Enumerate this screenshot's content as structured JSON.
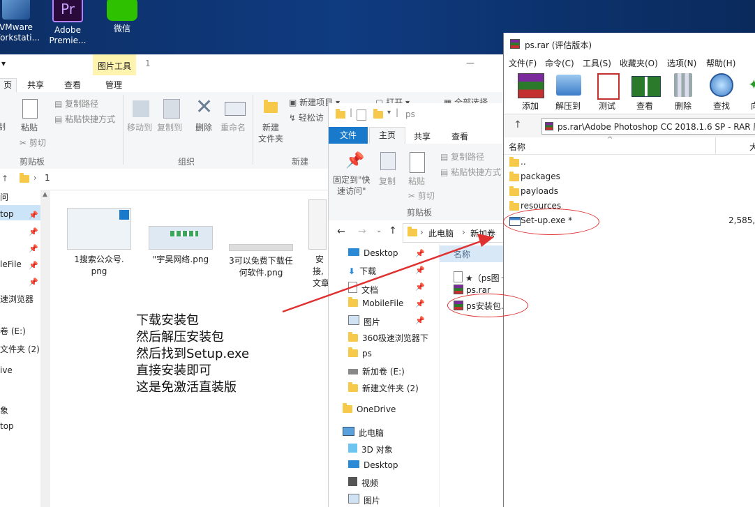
{
  "desktop": {
    "icons": [
      {
        "label1": "VMware",
        "label2": "Workstati..."
      },
      {
        "label1": "Adobe",
        "label2": "Premie..."
      },
      {
        "label1": "微信",
        "label2": ""
      }
    ]
  },
  "explorer1": {
    "context_tab": "图片工具",
    "window_title": "1",
    "tabs": [
      "页",
      "共享",
      "查看",
      "管理"
    ],
    "ribbon": {
      "copy_path": "复制路径",
      "paste_shortcut": "粘贴快捷方式",
      "cut": "剪切",
      "clipboard_group": "剪贴板",
      "paste": "粘贴",
      "copy_fragment": "制",
      "move_to": "移动到",
      "copy_to": "复制到",
      "delete": "删除",
      "rename": "重命名",
      "organize_group": "组织",
      "new_item": "新建项目",
      "easy_access": "轻松访",
      "new_folder_line1": "新建",
      "new_folder_line2": "文件夹",
      "new_group": "新建",
      "open": "打开",
      "select_all": "全部选择"
    },
    "address_path": "1",
    "nav_items": [
      {
        "label": "问",
        "pinned": false
      },
      {
        "label": "top",
        "pinned": true
      },
      {
        "label": "",
        "pinned": true
      },
      {
        "label": "",
        "pinned": true
      },
      {
        "label": "leFile",
        "pinned": true
      },
      {
        "label": "",
        "pinned": true
      },
      {
        "label": "速浏览器",
        "pinned": false
      },
      {
        "label": "卷 (E:)",
        "pinned": false
      },
      {
        "label": "文件夹 (2)",
        "pinned": false
      },
      {
        "label": "ive",
        "pinned": false
      },
      {
        "label": "象",
        "pinned": false
      },
      {
        "label": "top",
        "pinned": false
      }
    ],
    "files": [
      {
        "line1": "1搜索公众号.",
        "line2": "png"
      },
      {
        "line1": "\"宇昊网络.png",
        "line2": ""
      },
      {
        "line1": "3可以免费下载任",
        "line2": "何软件.png"
      },
      {
        "line1": "安",
        "line2": "接,",
        "line3": "文章"
      }
    ],
    "note_lines": [
      "下载安装包",
      "然后解压安装包",
      "然后找到Setup.exe",
      "直接安装即可",
      "这是免激活直装版"
    ]
  },
  "explorer2": {
    "title": "ps",
    "tabs": [
      "文件",
      "主页",
      "共享",
      "查看"
    ],
    "ribbon": {
      "pin_line1": "固定到\"快",
      "pin_line2": "速访问\"",
      "copy": "复制",
      "paste": "粘贴",
      "copy_path": "复制路径",
      "paste_shortcut": "粘贴快捷方式",
      "cut": "剪切",
      "clipboard_group": "剪贴板"
    },
    "breadcrumb": [
      "此电脑",
      "新加卷"
    ],
    "column_header": "名称",
    "nav_items": [
      {
        "label": "Desktop",
        "icon": "desktop",
        "pinned": true
      },
      {
        "label": "下载",
        "icon": "download",
        "pinned": true
      },
      {
        "label": "文档",
        "icon": "document",
        "pinned": true
      },
      {
        "label": "MobileFile",
        "icon": "folder",
        "pinned": true
      },
      {
        "label": "图片",
        "icon": "picture",
        "pinned": true
      },
      {
        "label": "360极速浏览器下",
        "icon": "folder",
        "pinned": false
      },
      {
        "label": "ps",
        "icon": "folder",
        "pinned": false
      },
      {
        "label": "新加卷 (E:)",
        "icon": "drive",
        "pinned": false
      },
      {
        "label": "新建文件夹 (2)",
        "icon": "folder",
        "pinned": false
      },
      {
        "label": "OneDrive",
        "icon": "folder",
        "pinned": false
      },
      {
        "label": "此电脑",
        "icon": "pc",
        "pinned": false
      },
      {
        "label": "3D 对象",
        "icon": "3d",
        "pinned": false
      },
      {
        "label": "Desktop",
        "icon": "desktop",
        "pinned": false
      },
      {
        "label": "视频",
        "icon": "video",
        "pinned": false
      },
      {
        "label": "图片",
        "icon": "picture",
        "pinned": false
      }
    ],
    "files": [
      {
        "label": "★（ps图᠁",
        "icon": "text"
      },
      {
        "label": "ps.rar",
        "icon": "rar"
      },
      {
        "label": "ps安装包.",
        "icon": "rar"
      }
    ]
  },
  "winrar": {
    "title": "ps.rar (评估版本)",
    "menu": [
      "文件(F)",
      "命令(C)",
      "工具(S)",
      "收藏夹(O)",
      "选项(N)",
      "帮助(H)"
    ],
    "toolbar": [
      "添加",
      "解压到",
      "测试",
      "查看",
      "删除",
      "查找",
      "向"
    ],
    "path": "ps.rar\\Adobe Photoshop CC 2018.1.6 SP - RAR 压",
    "col_name": "名称",
    "col_size": "大",
    "rows": [
      {
        "name": "..",
        "type": "folder",
        "size": ""
      },
      {
        "name": "packages",
        "type": "folder",
        "size": ""
      },
      {
        "name": "payloads",
        "type": "folder",
        "size": ""
      },
      {
        "name": "resources",
        "type": "folder",
        "size": ""
      },
      {
        "name": "Set-up.exe *",
        "type": "exe",
        "size": "2,585,2"
      }
    ]
  },
  "colors": {
    "accent": "#1979ca",
    "annotation": "#e03030",
    "desktop": "#0f3b80",
    "context_tab": "#fff3b0"
  }
}
